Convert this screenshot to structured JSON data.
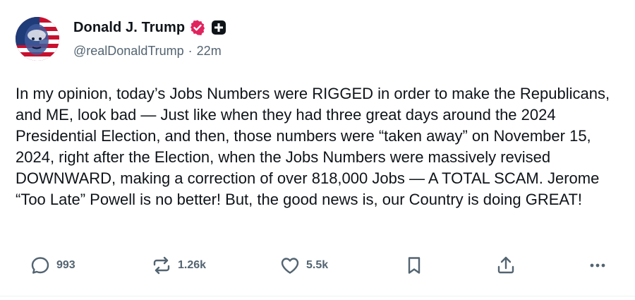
{
  "post": {
    "author": {
      "display_name": "Donald J. Trump",
      "handle": "@realDonaldTrump",
      "separator": "·",
      "time": "22m",
      "verified_icon": "verified-badge-icon",
      "plus_icon": "plus-badge-icon",
      "verified_color": "#e0245e"
    },
    "text": "In my opinion, today’s Jobs Numbers were RIGGED in order to make the Republicans, and ME, look bad — Just like when they had three great days around the 2024 Presidential Election, and then, those numbers were “taken away” on November 15, 2024, right after the Election, when the Jobs Numbers were massively revised DOWNWARD, making a correction of over 818,000 Jobs — A TOTAL SCAM. Jerome “Too Late” Powell is no better! But, the good news is, our Country is doing GREAT!",
    "actions": {
      "reply": {
        "icon": "reply-icon",
        "count": "993"
      },
      "repost": {
        "icon": "repost-icon",
        "count": "1.26k"
      },
      "like": {
        "icon": "heart-icon",
        "count": "5.5k"
      },
      "bookmark": {
        "icon": "bookmark-icon"
      },
      "share": {
        "icon": "share-icon"
      },
      "more": {
        "icon": "more-icon"
      }
    }
  },
  "colors": {
    "text": "#0f1419",
    "muted": "#536471",
    "badge": "#e0245e",
    "icon_gray": "#536471"
  }
}
